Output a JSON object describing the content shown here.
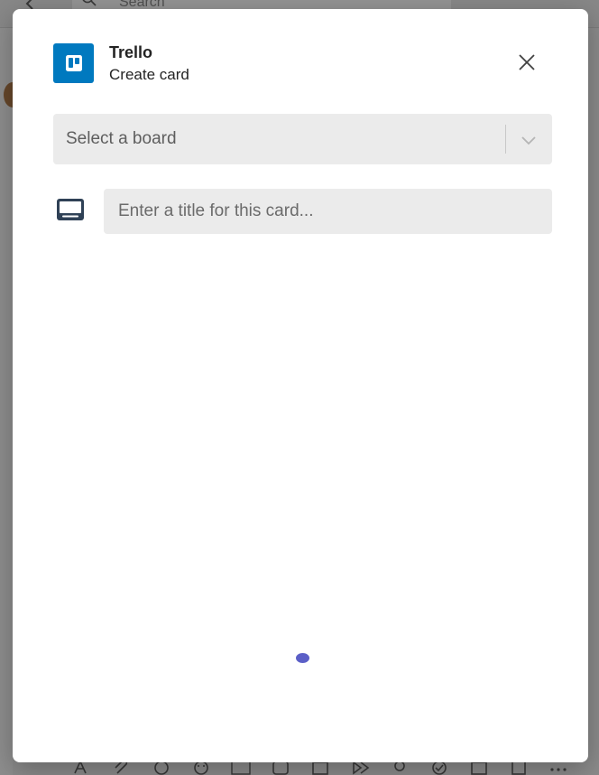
{
  "background": {
    "search_placeholder": "Search"
  },
  "dialog": {
    "app_name": "Trello",
    "subtitle": "Create card",
    "board_select": {
      "placeholder": "Select a board"
    },
    "card_title_input": {
      "placeholder": "Enter a title for this card...",
      "value": ""
    },
    "icons": {
      "app": "trello-logo-icon",
      "close": "close-icon",
      "chevron": "chevron-down-icon",
      "card": "card-icon",
      "loading": "loading-spinner"
    },
    "colors": {
      "trello_blue": "#0079bf",
      "spinner": "#5b5fc7",
      "field_background": "#ebebeb"
    }
  }
}
